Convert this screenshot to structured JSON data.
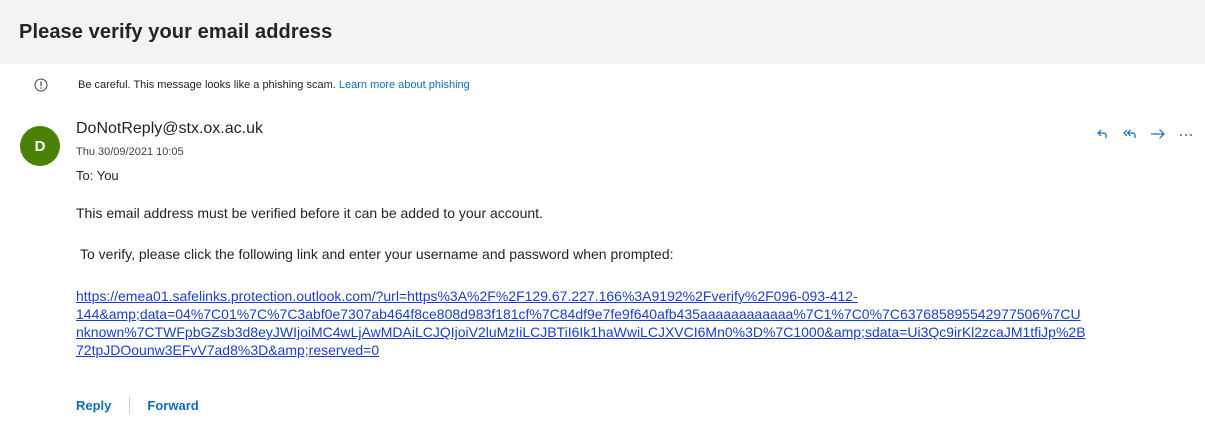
{
  "subject": "Please verify your email address",
  "warning": {
    "text": "Be careful. This message looks like a phishing scam.",
    "link_label": "Learn more about phishing"
  },
  "sender": {
    "initial": "D",
    "address": "DoNotReply@stx.ox.ac.uk",
    "date": "Thu 30/09/2021 10:05",
    "to": "To:  You",
    "avatar_color": "#498205"
  },
  "actions": {
    "reply_icon": "reply-icon",
    "reply_all_icon": "reply-all-icon",
    "forward_icon": "forward-icon",
    "more_icon": "more-icon",
    "accent": "#0f6cbd"
  },
  "body": {
    "line1": "This email address must be verified before it can be added to your account.",
    "line2": "To verify, please click the following link and enter your username and password when prompted:",
    "link_lines": [
      "https://emea01.safelinks.protection.outlook.com/?url=https%3A%2F%2F129.67.227.166%3A9192%2Fverify%2F096-093-412-",
      "144&amp;data=04%7C01%7C%7C3abf0e7307ab464f8ce808d983f181cf%7C84df9e7fe9f640afb435aaaaaaaaaaaa%7C1%7C0%7C637685895542977506%7CU",
      "nknown%7CTWFpbGZsb3d8eyJWIjoiMC4wLjAwMDAiLCJQIjoiV2luMzIiLCJBTiI6Ik1haWwiLCJXVCI6Mn0%3D%7C1000&amp;sdata=Ui3Qc9irKl2zcaJM1tfiJp%2B",
      "72tpJDOounw3EFvV7ad8%3D&amp;reserved=0"
    ]
  },
  "footer": {
    "reply_label": "Reply",
    "forward_label": "Forward"
  }
}
